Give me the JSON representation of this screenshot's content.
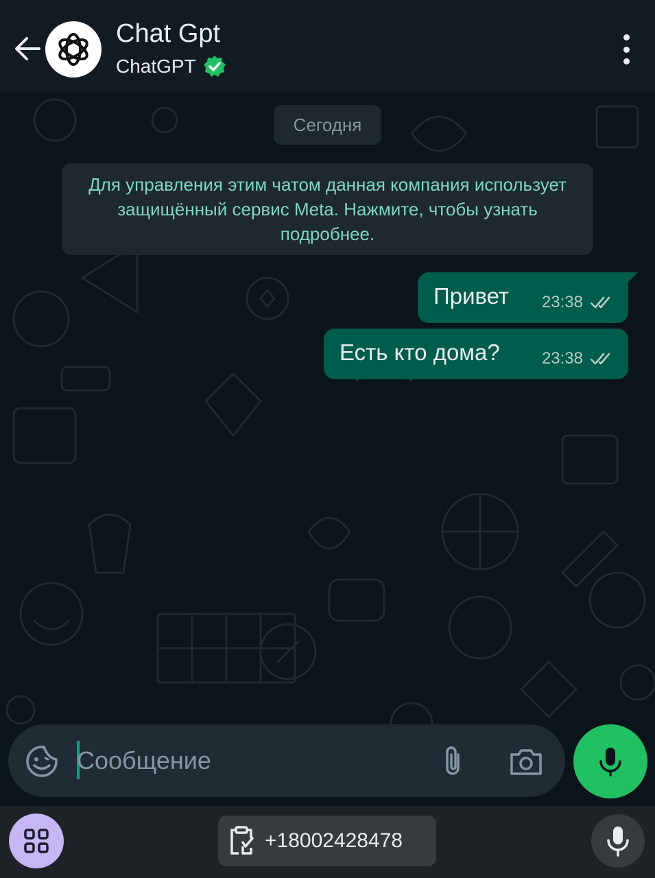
{
  "header": {
    "title": "Chat Gpt",
    "subtitle": "ChatGPT",
    "verified_icon": "verified-badge-icon",
    "avatar_icon": "openai-logo-icon"
  },
  "chat": {
    "date_label": "Сегодня",
    "system_message": "Для управления этим чатом данная компания использует защищённый сервис Meta. Нажмите, чтобы узнать подробнее.",
    "messages": [
      {
        "text": "Привет",
        "time": "23:38",
        "status": "read"
      },
      {
        "text": "Есть кто дома?",
        "time": "23:38",
        "status": "read"
      }
    ]
  },
  "composer": {
    "placeholder": "Сообщение",
    "value": ""
  },
  "keyboard_bar": {
    "clipboard_text": "+18002428478"
  },
  "colors": {
    "header_bg": "#111b21",
    "chat_bg": "#0b141a",
    "outgoing_bubble": "#005c4b",
    "accent_green": "#21c063",
    "system_text": "#7fd6c2"
  }
}
